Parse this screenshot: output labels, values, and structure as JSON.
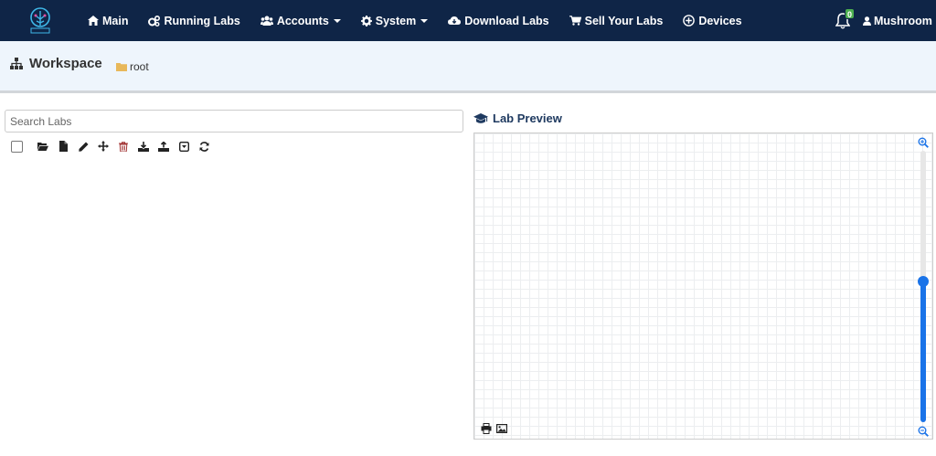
{
  "nav": {
    "logo_icon": "pnet-tree-logo",
    "items": [
      {
        "label": "Main",
        "icon": "home-icon"
      },
      {
        "label": "Running Labs",
        "icon": "cogs-icon"
      },
      {
        "label": "Accounts",
        "icon": "users-icon",
        "dropdown": true
      },
      {
        "label": "System",
        "icon": "gear-icon",
        "dropdown": true
      },
      {
        "label": "Download Labs",
        "icon": "cloud-download-icon"
      },
      {
        "label": "Sell Your Labs",
        "icon": "cart-icon"
      },
      {
        "label": "Devices",
        "icon": "plus-circle-icon"
      }
    ],
    "notifications_count": "0",
    "user_name": "Mushroom"
  },
  "workspace": {
    "title": "Workspace",
    "breadcrumb": "root"
  },
  "search": {
    "placeholder": "Search Labs"
  },
  "toolbar": {
    "icons": [
      "select-all-checkbox",
      "open-folder-icon",
      "new-file-icon",
      "edit-icon",
      "move-icon",
      "delete-icon",
      "import-icon",
      "export-icon",
      "collapse-icon",
      "refresh-icon"
    ]
  },
  "preview": {
    "title": "Lab Preview",
    "zoom_level": 0.52
  },
  "colors": {
    "navbar": "#0f2547",
    "header_bg": "#eef5fc",
    "accent": "#1a73e8",
    "badge": "#4caf50"
  }
}
